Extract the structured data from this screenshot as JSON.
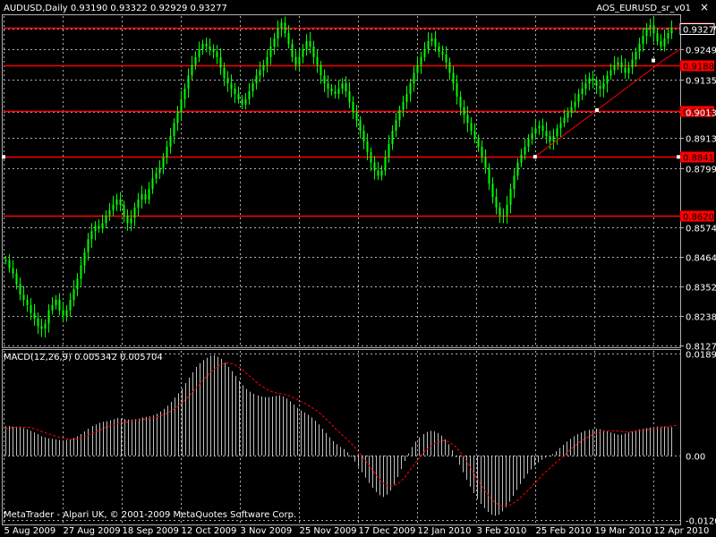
{
  "header": {
    "symbol_line": "AUDUSD,Daily  0.93190 0.93322 0.92929 0.93277",
    "indicator": "AOS_EURUSD_sr_v01",
    "close_glyph": "×"
  },
  "macd_header": "MACD(12,26,9) 0.005342 0.005704",
  "footer": {
    "copyright": "MetaTrader - Alpari UK, © 2001-2009 MetaQuotes Software Corp."
  },
  "colors": {
    "background": "#000000",
    "grid": "#b0b0b0",
    "candle": "#00ff00",
    "sr_line": "#ff0000",
    "trend_line": "#ff0000",
    "macd_hist": "#c0c0c0",
    "signal": "#ff0000",
    "text": "#ffffff",
    "price_label_bg": "#ff0000",
    "price_label_text": "#000000"
  },
  "chart_data": [
    {
      "type": "line",
      "title": "AUDUSD,Daily",
      "dates": [
        "5 Aug 2009",
        "27 Aug 2009",
        "18 Sep 2009",
        "12 Oct 2009",
        "3 Nov 2009",
        "25 Nov 2009",
        "17 Dec 2009",
        "12 Jan 2010",
        "3 Feb 2010",
        "25 Feb 2010",
        "19 Mar 2010",
        "12 Apr 2010"
      ],
      "price_ticks": [
        0.9327,
        0.9249,
        0.9135,
        0.9013,
        0.8913,
        0.8799,
        0.8574,
        0.8464,
        0.8352,
        0.8238,
        0.8127
      ],
      "current_price": 0.93277,
      "ylim": [
        0.8127,
        0.9375
      ],
      "support_resistance": [
        0.93312,
        0.91885,
        0.90157,
        0.88414,
        0.86203
      ],
      "trendline": {
        "start": {
          "date": "25 Feb 2010",
          "value": 0.8842
        },
        "end": {
          "date": "22 Apr 2010",
          "value": 0.921
        }
      },
      "closes": [
        0.845,
        0.842,
        0.84,
        0.836,
        0.832,
        0.83,
        0.828,
        0.825,
        0.823,
        0.82,
        0.819,
        0.821,
        0.826,
        0.828,
        0.83,
        0.826,
        0.824,
        0.826,
        0.83,
        0.834,
        0.838,
        0.843,
        0.848,
        0.853,
        0.856,
        0.858,
        0.857,
        0.859,
        0.862,
        0.864,
        0.866,
        0.868,
        0.866,
        0.862,
        0.859,
        0.861,
        0.865,
        0.868,
        0.87,
        0.868,
        0.872,
        0.876,
        0.878,
        0.88,
        0.884,
        0.888,
        0.892,
        0.897,
        0.901,
        0.906,
        0.91,
        0.915,
        0.919,
        0.922,
        0.925,
        0.927,
        0.926,
        0.925,
        0.924,
        0.922,
        0.918,
        0.914,
        0.912,
        0.91,
        0.908,
        0.906,
        0.904,
        0.906,
        0.909,
        0.912,
        0.915,
        0.917,
        0.919,
        0.922,
        0.926,
        0.929,
        0.933,
        0.935,
        0.931,
        0.927,
        0.922,
        0.919,
        0.922,
        0.925,
        0.928,
        0.926,
        0.922,
        0.919,
        0.915,
        0.912,
        0.91,
        0.909,
        0.908,
        0.91,
        0.912,
        0.909,
        0.905,
        0.901,
        0.898,
        0.894,
        0.89,
        0.886,
        0.882,
        0.879,
        0.877,
        0.879,
        0.884,
        0.889,
        0.894,
        0.898,
        0.902,
        0.905,
        0.908,
        0.912,
        0.916,
        0.919,
        0.922,
        0.925,
        0.928,
        0.929,
        0.926,
        0.924,
        0.923,
        0.92,
        0.916,
        0.912,
        0.907,
        0.903,
        0.9,
        0.897,
        0.894,
        0.891,
        0.888,
        0.884,
        0.88,
        0.874,
        0.869,
        0.865,
        0.862,
        0.862,
        0.866,
        0.872,
        0.877,
        0.882,
        0.885,
        0.888,
        0.891,
        0.893,
        0.895,
        0.896,
        0.894,
        0.892,
        0.89,
        0.892,
        0.895,
        0.897,
        0.899,
        0.901,
        0.903,
        0.905,
        0.908,
        0.91,
        0.912,
        0.914,
        0.913,
        0.911,
        0.91,
        0.912,
        0.915,
        0.917,
        0.919,
        0.92,
        0.918,
        0.916,
        0.918,
        0.921,
        0.924,
        0.927,
        0.93,
        0.933,
        0.934,
        0.931,
        0.928,
        0.926,
        0.929,
        0.931,
        0.933
      ]
    },
    {
      "type": "bar",
      "title": "MACD(12,26,9) 0.005342 0.005704",
      "ticks": [
        0.01894,
        0.0,
        -0.01207
      ],
      "ylim": [
        -0.0125,
        0.0195
      ],
      "macd": [
        0.0055,
        0.0055,
        0.0054,
        0.0054,
        0.0053,
        0.0051,
        0.0049,
        0.0046,
        0.0043,
        0.004,
        0.0036,
        0.0034,
        0.0032,
        0.0031,
        0.003,
        0.0029,
        0.0028,
        0.0029,
        0.003,
        0.0033,
        0.0036,
        0.004,
        0.0045,
        0.005,
        0.0055,
        0.0058,
        0.0061,
        0.0063,
        0.0064,
        0.0066,
        0.0068,
        0.007,
        0.0069,
        0.0068,
        0.0067,
        0.0067,
        0.0068,
        0.0069,
        0.0071,
        0.0072,
        0.0073,
        0.0075,
        0.0078,
        0.0082,
        0.0087,
        0.0093,
        0.01,
        0.0108,
        0.0116,
        0.0125,
        0.0135,
        0.0145,
        0.0155,
        0.0165,
        0.0172,
        0.0178,
        0.0182,
        0.0186,
        0.0187,
        0.0184,
        0.018,
        0.0173,
        0.0165,
        0.0157,
        0.0148,
        0.0139,
        0.0131,
        0.0124,
        0.0119,
        0.0115,
        0.0112,
        0.011,
        0.0109,
        0.0109,
        0.011,
        0.0111,
        0.0112,
        0.011,
        0.0106,
        0.0101,
        0.0095,
        0.0089,
        0.0084,
        0.008,
        0.0076,
        0.0071,
        0.0065,
        0.0058,
        0.005,
        0.0042,
        0.0034,
        0.0027,
        0.0021,
        0.0016,
        0.0012,
        0.0006,
        -0.0002,
        -0.0011,
        -0.0021,
        -0.0031,
        -0.0041,
        -0.0051,
        -0.006,
        -0.0068,
        -0.0074,
        -0.0077,
        -0.0073,
        -0.0065,
        -0.0054,
        -0.004,
        -0.0025,
        -0.001,
        0.0004,
        0.0016,
        0.0026,
        0.0034,
        0.004,
        0.0044,
        0.0046,
        0.0045,
        0.0042,
        0.0037,
        0.003,
        0.0021,
        0.001,
        -0.0003,
        -0.0017,
        -0.0031,
        -0.0045,
        -0.0058,
        -0.007,
        -0.0081,
        -0.009,
        -0.0098,
        -0.0105,
        -0.011,
        -0.0112,
        -0.011,
        -0.0104,
        -0.0096,
        -0.0086,
        -0.0075,
        -0.0064,
        -0.0053,
        -0.0043,
        -0.0034,
        -0.0026,
        -0.0019,
        -0.0013,
        -0.0008,
        -0.0004,
        -0.0001,
        0.0003,
        0.0008,
        0.0014,
        0.002,
        0.0026,
        0.0031,
        0.0036,
        0.004,
        0.0043,
        0.0046,
        0.0048,
        0.0049,
        0.005,
        0.0049,
        0.0047,
        0.0045,
        0.0043,
        0.0041,
        0.0039,
        0.0039,
        0.0041,
        0.0043,
        0.0045,
        0.0047,
        0.0049,
        0.005,
        0.0051,
        0.0052,
        0.0053,
        0.0054,
        0.0054,
        0.0054,
        0.0053,
        0.0053
      ],
      "signal": [
        0.005,
        0.0051,
        0.0052,
        0.0053,
        0.0053,
        0.0053,
        0.0053,
        0.0052,
        0.005,
        0.0048,
        0.0045,
        0.0043,
        0.004,
        0.0038,
        0.0036,
        0.0034,
        0.0032,
        0.0031,
        0.003,
        0.003,
        0.0031,
        0.0033,
        0.0035,
        0.0038,
        0.0041,
        0.0044,
        0.0047,
        0.005,
        0.0053,
        0.0055,
        0.0057,
        0.0059,
        0.0061,
        0.0062,
        0.0063,
        0.0064,
        0.0065,
        0.0066,
        0.0067,
        0.0068,
        0.0069,
        0.007,
        0.0072,
        0.0074,
        0.0076,
        0.0079,
        0.0083,
        0.0087,
        0.0092,
        0.0098,
        0.0104,
        0.0111,
        0.0118,
        0.0126,
        0.0133,
        0.0141,
        0.0148,
        0.0155,
        0.0161,
        0.0166,
        0.017,
        0.0172,
        0.0172,
        0.0171,
        0.0168,
        0.0164,
        0.0159,
        0.0153,
        0.0147,
        0.0141,
        0.0135,
        0.013,
        0.0126,
        0.0122,
        0.0119,
        0.0117,
        0.0116,
        0.0115,
        0.0113,
        0.0111,
        0.0108,
        0.0105,
        0.0101,
        0.0098,
        0.0094,
        0.009,
        0.0086,
        0.0081,
        0.0075,
        0.0069,
        0.0062,
        0.0055,
        0.0048,
        0.0042,
        0.0036,
        0.003,
        0.0023,
        0.0016,
        0.0008,
        0.0,
        -0.0009,
        -0.0018,
        -0.0027,
        -0.0036,
        -0.0044,
        -0.0051,
        -0.0055,
        -0.0057,
        -0.0056,
        -0.0053,
        -0.0047,
        -0.004,
        -0.0031,
        -0.0022,
        -0.0013,
        -0.0004,
        0.0004,
        0.0011,
        0.0017,
        0.0022,
        0.0025,
        0.0027,
        0.0028,
        0.0026,
        0.0022,
        0.0017,
        0.001,
        0.0001,
        -0.0009,
        -0.002,
        -0.0031,
        -0.0042,
        -0.0053,
        -0.0063,
        -0.0072,
        -0.008,
        -0.0087,
        -0.0091,
        -0.0094,
        -0.0094,
        -0.0093,
        -0.0089,
        -0.0085,
        -0.0079,
        -0.0073,
        -0.0066,
        -0.0059,
        -0.0052,
        -0.0045,
        -0.0038,
        -0.0031,
        -0.0025,
        -0.0019,
        -0.0013,
        -0.0007,
        -0.0001,
        0.0005,
        0.0011,
        0.0017,
        0.0022,
        0.0027,
        0.0031,
        0.0035,
        0.0038,
        0.0041,
        0.0043,
        0.0045,
        0.0046,
        0.0046,
        0.0046,
        0.0046,
        0.0045,
        0.0044,
        0.0044,
        0.0044,
        0.0045,
        0.0046,
        0.0047,
        0.0048,
        0.0049,
        0.005,
        0.0051,
        0.0052,
        0.0053,
        0.0054,
        0.0055,
        0.0056,
        0.0057
      ]
    }
  ]
}
